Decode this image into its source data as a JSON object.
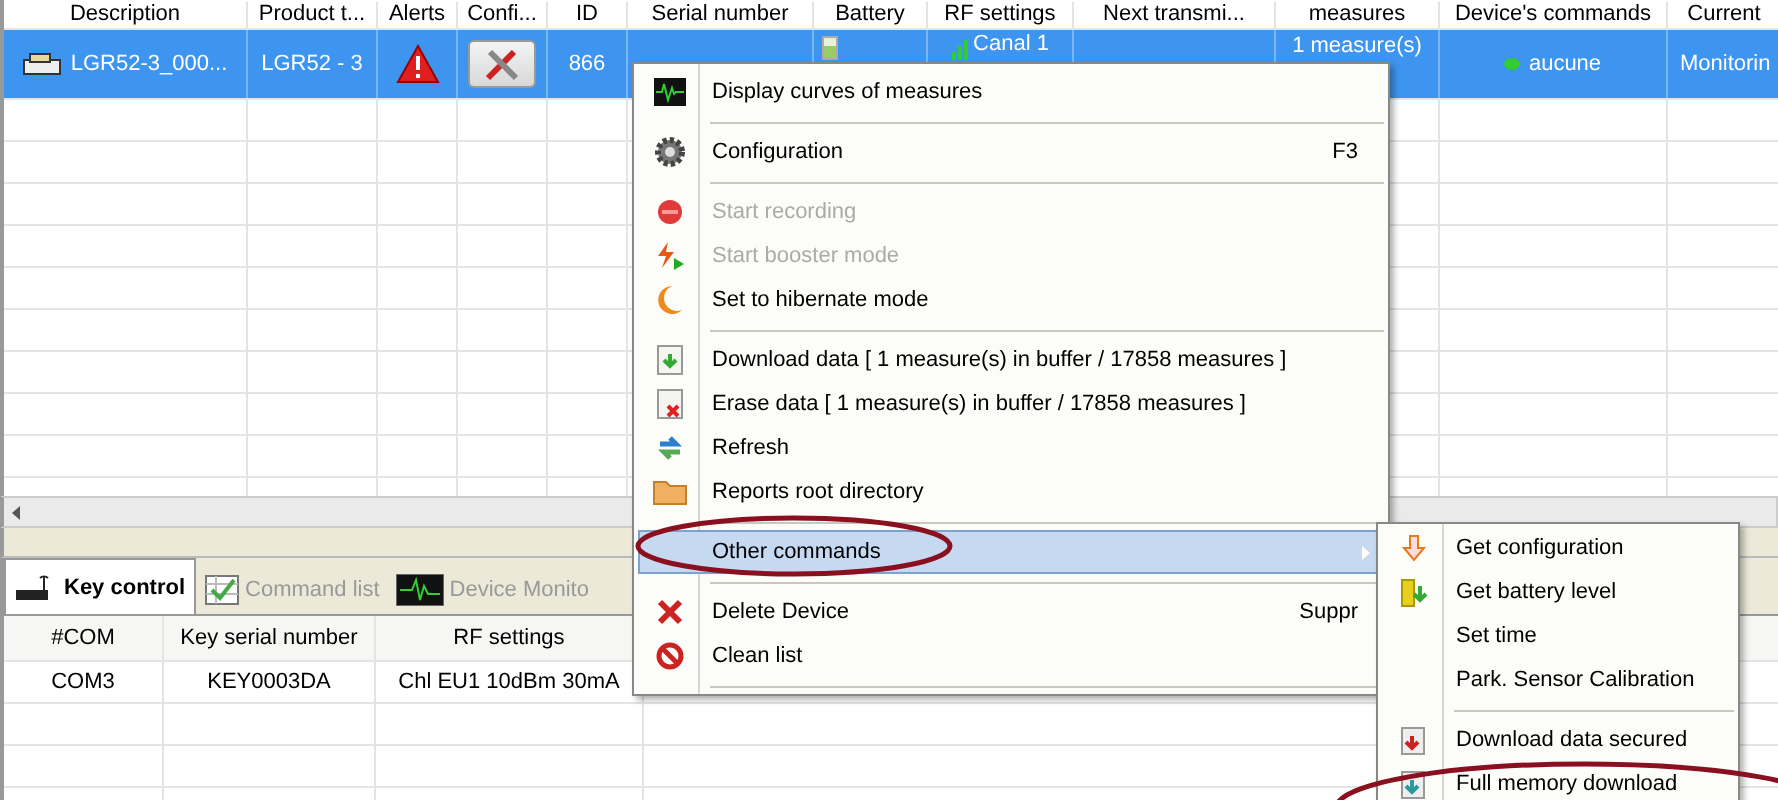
{
  "device_table": {
    "columns": [
      "Description",
      "Product t...",
      "Alerts",
      "Confi...",
      "ID",
      "Serial number",
      "Battery",
      "RF settings",
      "Next transmi...",
      "measures",
      "Device's commands",
      "Current"
    ],
    "rows": [
      {
        "selected": true,
        "description": "LGR52-3_000...",
        "product_type": "LGR52 - 3",
        "id": "866",
        "rf_settings": "Canal 1",
        "measures": "1 measure(s)",
        "commands": "aucune",
        "current": "Monitorin"
      }
    ]
  },
  "context_menu": {
    "items": [
      {
        "kind": "item",
        "label": "Display curves of measures",
        "disabled": false,
        "selected": false
      },
      {
        "kind": "separator"
      },
      {
        "kind": "item",
        "label": "Configuration",
        "shortcut": "F3",
        "disabled": false,
        "selected": false
      },
      {
        "kind": "separator"
      },
      {
        "kind": "item",
        "label": "Start recording",
        "disabled": true,
        "selected": false
      },
      {
        "kind": "item",
        "label": "Start booster mode",
        "disabled": true,
        "selected": false
      },
      {
        "kind": "item",
        "label": "Set to hibernate mode",
        "disabled": false,
        "selected": false
      },
      {
        "kind": "separator"
      },
      {
        "kind": "item",
        "label": "Download data   [ 1 measure(s) in buffer / 17858 measures ]",
        "disabled": false,
        "selected": false
      },
      {
        "kind": "item",
        "label": "Erase data   [ 1 measure(s) in buffer / 17858 measures ]",
        "disabled": false,
        "selected": false
      },
      {
        "kind": "item",
        "label": "Refresh",
        "disabled": false,
        "selected": false
      },
      {
        "kind": "item",
        "label": "Reports root directory",
        "disabled": false,
        "selected": false
      },
      {
        "kind": "separator"
      },
      {
        "kind": "submenu",
        "label": "Other commands",
        "disabled": false,
        "selected": true
      },
      {
        "kind": "separator"
      },
      {
        "kind": "item",
        "label": "Delete Device",
        "shortcut": "Suppr",
        "disabled": false,
        "selected": false
      },
      {
        "kind": "item",
        "label": "Clean list",
        "disabled": false,
        "selected": false
      },
      {
        "kind": "separator"
      }
    ]
  },
  "submenu": {
    "items": [
      {
        "kind": "item",
        "label": "Get configuration"
      },
      {
        "kind": "item",
        "label": "Get battery level"
      },
      {
        "kind": "item",
        "label": "Set time"
      },
      {
        "kind": "item",
        "label": "Park. Sensor Calibration"
      },
      {
        "kind": "separator"
      },
      {
        "kind": "item",
        "label": "Download data secured"
      },
      {
        "kind": "item",
        "label": "Full memory download"
      }
    ]
  },
  "tabs": [
    {
      "label": "Key control",
      "selected": true
    },
    {
      "label": "Command list",
      "selected": false
    },
    {
      "label": "Device Monito",
      "selected": false
    }
  ],
  "key_table": {
    "columns": [
      "#COM",
      "Key serial number",
      "RF settings"
    ],
    "rows": [
      {
        "com": "COM3",
        "serial": "KEY0003DA",
        "rf": "Chl EU1  10dBm 30mA"
      }
    ]
  }
}
